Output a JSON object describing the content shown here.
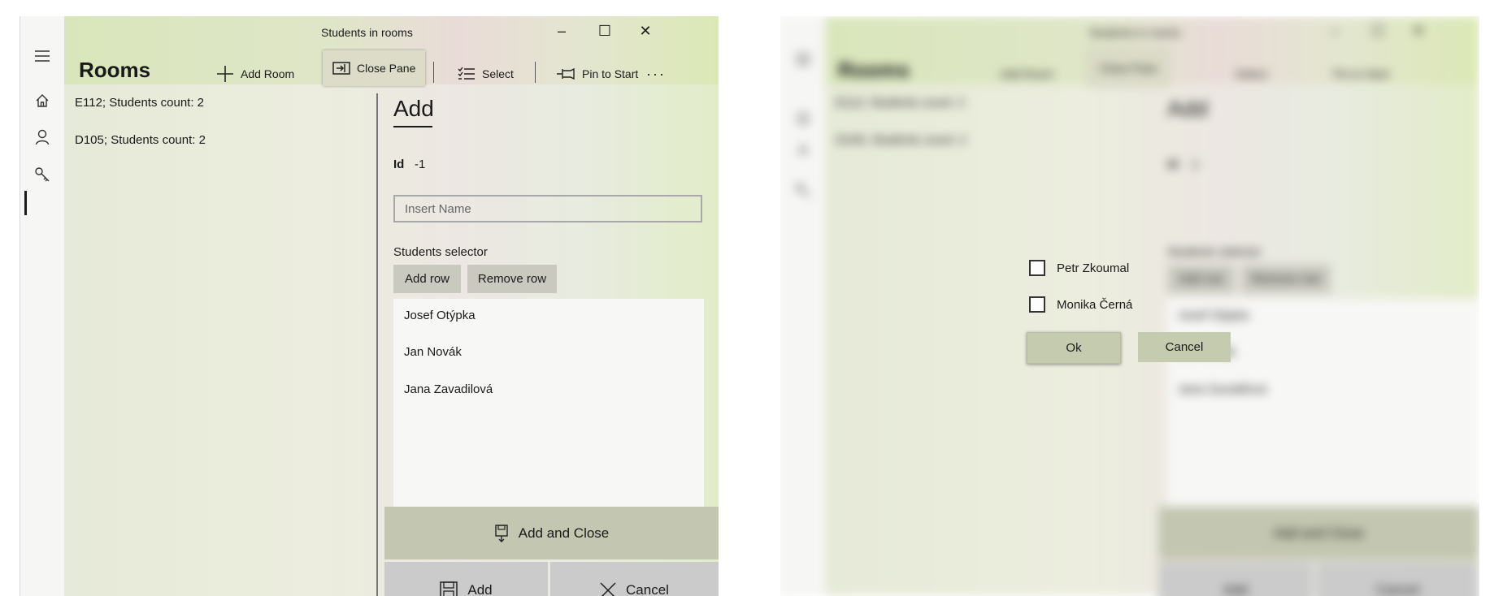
{
  "window": {
    "title": "Students in rooms",
    "minimize_glyph": "–",
    "maximize_glyph": "☐",
    "close_glyph": "✕"
  },
  "nav": {
    "items": [
      {
        "icon": "hamburger-icon"
      },
      {
        "icon": "home-icon"
      },
      {
        "icon": "person-icon"
      },
      {
        "icon": "key-icon",
        "selected": true
      }
    ]
  },
  "page": {
    "title": "Rooms"
  },
  "toolbar": {
    "add_room": "Add Room",
    "close_pane": "Close Pane",
    "select": "Select",
    "pin_to_start": "Pin to Start",
    "more": "···"
  },
  "rooms": [
    {
      "label": "E112; Students count: 2"
    },
    {
      "label": "D105; Students count: 2"
    }
  ],
  "pane": {
    "heading": "Add",
    "id_label": "Id",
    "id_value": "-1",
    "name_placeholder": "Insert Name",
    "selector_label": "Students selector",
    "add_row": "Add row",
    "remove_row": "Remove row",
    "students": [
      "Josef Otýpka",
      "Jan Novák",
      "Jana Zavadilová"
    ],
    "add_and_close": "Add and Close",
    "add": "Add",
    "cancel": "Cancel"
  },
  "dialog": {
    "options": [
      {
        "label": "Petr Zkoumal",
        "checked": false
      },
      {
        "label": "Monika Černá",
        "checked": false
      }
    ],
    "ok": "Ok",
    "cancel": "Cancel"
  }
}
